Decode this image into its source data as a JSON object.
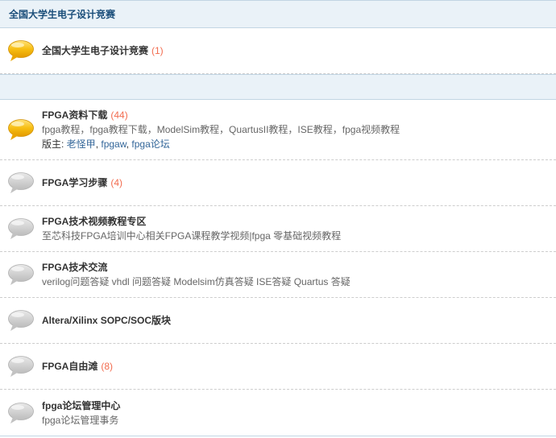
{
  "category_top": {
    "title": "全国大学生电子设计竞赛"
  },
  "forum_top": {
    "name": "全国大学生电子设计竞赛",
    "count": "(1)"
  },
  "forums": [
    {
      "name": "FPGA资料下载",
      "count": "(44)",
      "desc": "fpga教程，fpga教程下载，ModelSim教程，QuartusII教程，ISE教程，fpga视频教程",
      "mod_prefix": "版主: ",
      "mods": [
        "老怪甲",
        "fpgaw",
        "fpga论坛"
      ],
      "icon": "speech-bubble-new"
    },
    {
      "name": "FPGA学习步骤",
      "count": "(4)",
      "icon": "speech-bubble-old"
    },
    {
      "name": "FPGA技术视频教程专区",
      "desc": "至芯科技FPGA培训中心相关FPGA课程教学视频|fpga 零基础视频教程",
      "icon": "speech-bubble-old"
    },
    {
      "name": "FPGA技术交流",
      "desc": "verilog问题答疑 vhdl 问题答疑 Modelsim仿真答疑 ISE答疑 Quartus 答疑",
      "icon": "speech-bubble-old"
    },
    {
      "name": "Altera/Xilinx SOPC/SOC版块",
      "icon": "speech-bubble-old"
    },
    {
      "name": "FPGA自由滩",
      "count": "(8)",
      "icon": "speech-bubble-old"
    },
    {
      "name": "fpga论坛管理中心",
      "desc": "fpga论坛管理事务",
      "icon": "speech-bubble-old"
    }
  ],
  "colors": {
    "header_bg": "#eaf2f8",
    "header_border": "#c2d5e3",
    "count": "#f26c4f",
    "link": "#336699",
    "new_icon": "#f5b400",
    "old_icon": "#c8c8c8"
  }
}
